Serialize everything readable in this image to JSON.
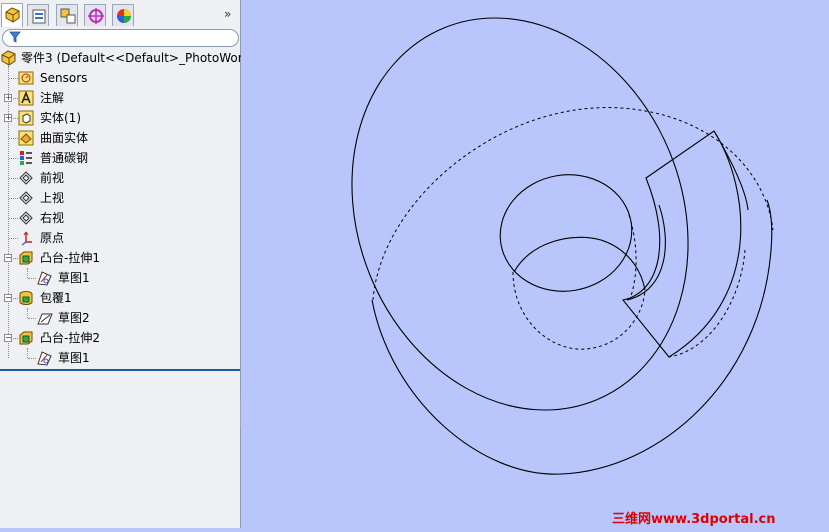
{
  "sidebar": {
    "tabs": [
      {
        "name": "feature-manager-tab",
        "icon": "feature-tree-icon",
        "active": true
      },
      {
        "name": "property-manager-tab",
        "icon": "property-manager-icon",
        "active": false
      },
      {
        "name": "configuration-manager-tab",
        "icon": "configuration-manager-icon",
        "active": false
      },
      {
        "name": "dimxpert-manager-tab",
        "icon": "crosshair-icon",
        "active": false
      },
      {
        "name": "display-manager-tab",
        "icon": "color-wheel-icon",
        "active": false
      }
    ],
    "more_label": "»",
    "tree": {
      "root": "零件3  (Default<<Default>_PhotoWorl",
      "items": [
        {
          "label": "Sensors",
          "icon": "sensors-icon"
        },
        {
          "label": "注解",
          "icon": "annotations-icon"
        },
        {
          "label": "实体(1)",
          "icon": "solid-bodies-icon"
        },
        {
          "label": "曲面实体",
          "icon": "surface-bodies-icon"
        },
        {
          "label": "普通碳钢",
          "icon": "material-icon"
        },
        {
          "label": "前视",
          "icon": "plane-icon"
        },
        {
          "label": "上视",
          "icon": "plane-icon"
        },
        {
          "label": "右视",
          "icon": "plane-icon"
        },
        {
          "label": "原点",
          "icon": "origin-icon"
        },
        {
          "label": "凸台-拉伸1",
          "icon": "boss-extrude-icon"
        },
        {
          "label": "草图1",
          "icon": "sketch-icon"
        },
        {
          "label": "包覆1",
          "icon": "wrap-icon"
        },
        {
          "label": "草图2",
          "icon": "sketch-icon"
        },
        {
          "label": "凸台-拉伸2",
          "icon": "boss-extrude-icon"
        },
        {
          "label": "草图1",
          "icon": "sketch-icon"
        }
      ]
    }
  },
  "viewport": {
    "background": "#b8c6fb",
    "watermark": "三维网www.3dportal.cn"
  },
  "colors": {
    "watermark": "#e00000",
    "selection_line": "#1f57a8"
  }
}
